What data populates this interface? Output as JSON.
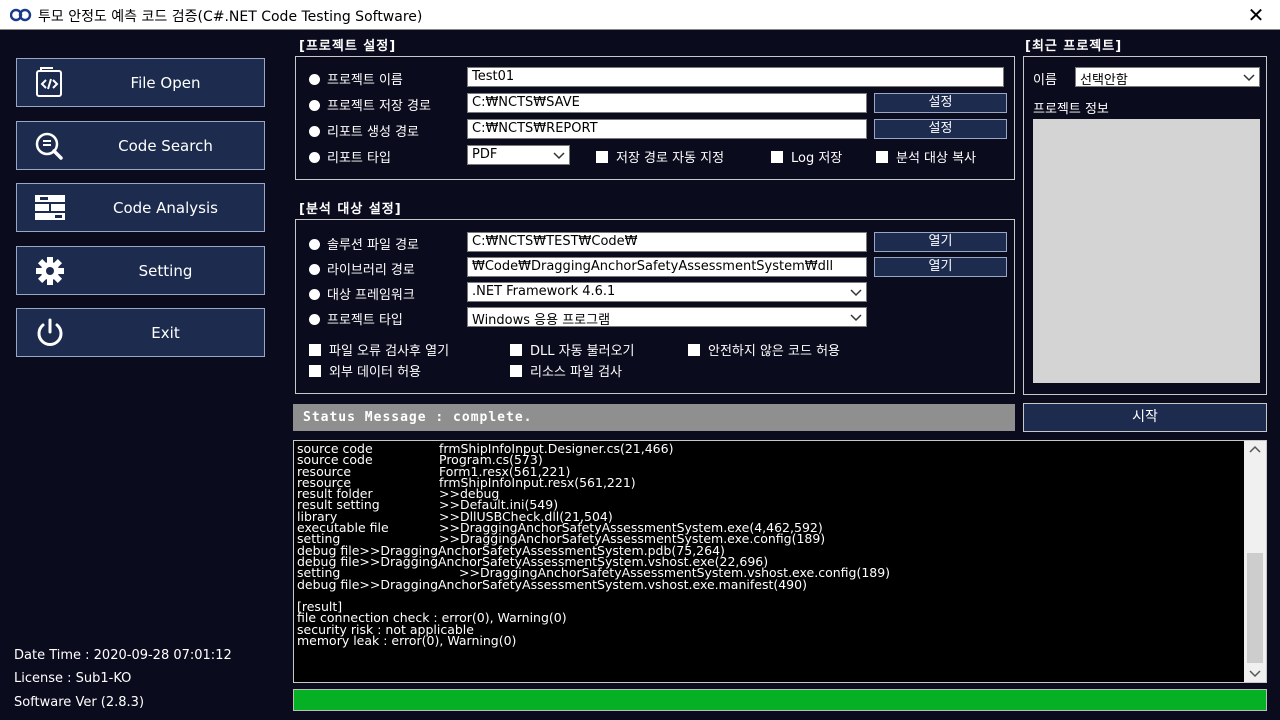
{
  "window": {
    "title": "투모 안정도 예측 코드 검증(C#.NET Code Testing Software)"
  },
  "nav": [
    {
      "label": "File Open",
      "icon": "file-code-icon"
    },
    {
      "label": "Code Search",
      "icon": "search-code-icon"
    },
    {
      "label": "Code Analysis",
      "icon": "analysis-icon"
    },
    {
      "label": "Setting",
      "icon": "gear-icon"
    },
    {
      "label": "Exit",
      "icon": "power-icon"
    }
  ],
  "info": {
    "datetime": "Date Time : 2020-09-28 07:01:12",
    "license": "License : Sub1-KO",
    "version": "Software Ver (2.8.3)"
  },
  "project_settings": {
    "header": "[프로젝트 설정]",
    "name_label": "프로젝트 이름",
    "name_value": "Test01",
    "save_path_label": "프로젝트 저장 경로",
    "save_path_value": "C:₩NCTS₩SAVE",
    "save_path_button": "설정",
    "report_path_label": "리포트 생성 경로",
    "report_path_value": "C:₩NCTS₩REPORT",
    "report_path_button": "설정",
    "report_type_label": "리포트 타입",
    "report_type_value": "PDF",
    "chk_auto_path": "저장 경로 자동 지정",
    "chk_log": "Log 저장",
    "chk_copy": "분석 대상 복사"
  },
  "analysis_settings": {
    "header": "[분석 대상 설정]",
    "solution_label": "솔루션 파일 경로",
    "solution_value": "C:₩NCTS₩TEST₩Code₩",
    "solution_button": "열기",
    "library_label": "라이브러리 경로",
    "library_value": "₩Code₩DraggingAnchorSafetyAssessmentSystem₩dll",
    "library_button": "열기",
    "framework_label": "대상 프레임워크",
    "framework_value": ".NET Framework 4.6.1",
    "project_type_label": "프로젝트 타입",
    "project_type_value": "Windows 응용 프로그램",
    "chk_open_after_check": "파일 오류 검사후 열기",
    "chk_dll_auto": "DLL 자동 불러오기",
    "chk_unsafe": "안전하지 않은 코드 허용",
    "chk_external": "외부 데이터 허용",
    "chk_resource": "리소스 파일 검사"
  },
  "recent": {
    "header": "[최근 프로젝트]",
    "name_label": "이름",
    "name_value": "선택안함",
    "info_label": "프로젝트 정보"
  },
  "status": {
    "message": "Status Message : complete."
  },
  "start_button": "시작",
  "log": [
    {
      "k": "source code",
      "v": "frmShipInfoInput.Designer.cs(21,466)"
    },
    {
      "k": "source code",
      "v": "Program.cs(573)"
    },
    {
      "k": "resource",
      "v": "Form1.resx(561,221)"
    },
    {
      "k": "resource",
      "v": "frmShipInfoInput.resx(561,221)"
    },
    {
      "k": "result folder",
      "v": ">>debug"
    },
    {
      "k": "result setting",
      "v": ">>Default.ini(549)"
    },
    {
      "k": "library",
      "v": ">>DllUSBCheck.dll(21,504)"
    },
    {
      "k": "executable file",
      "v": ">>DraggingAnchorSafetyAssessmentSystem.exe(4,462,592)"
    },
    {
      "k": "setting",
      "v": ">>DraggingAnchorSafetyAssessmentSystem.exe.config(189)"
    },
    {
      "k": "",
      "v": "debug file>>DraggingAnchorSafetyAssessmentSystem.pdb(75,264)"
    },
    {
      "k": "",
      "v": "debug file>>DraggingAnchorSafetyAssessmentSystem.vshost.exe(22,696)"
    },
    {
      "k": "setting",
      "v": ">>DraggingAnchorSafetyAssessmentSystem.vshost.exe.config(189)",
      "wide": true
    },
    {
      "k": "",
      "v": "debug file>>DraggingAnchorSafetyAssessmentSystem.vshost.exe.manifest(490)"
    },
    {
      "k": "",
      "v": ""
    },
    {
      "k": "",
      "v": "[result]"
    },
    {
      "k": "",
      "v": "file connection check : error(0), Warning(0)"
    },
    {
      "k": "",
      "v": "security risk : not applicable"
    },
    {
      "k": "",
      "v": "memory leak : error(0), Warning(0)"
    }
  ],
  "progress": {
    "value": 1.0,
    "color": "#06b025"
  },
  "colors": {
    "background": "#0b0b1e",
    "button": "#1c2b4e",
    "status_bar": "#8f8f8f"
  }
}
